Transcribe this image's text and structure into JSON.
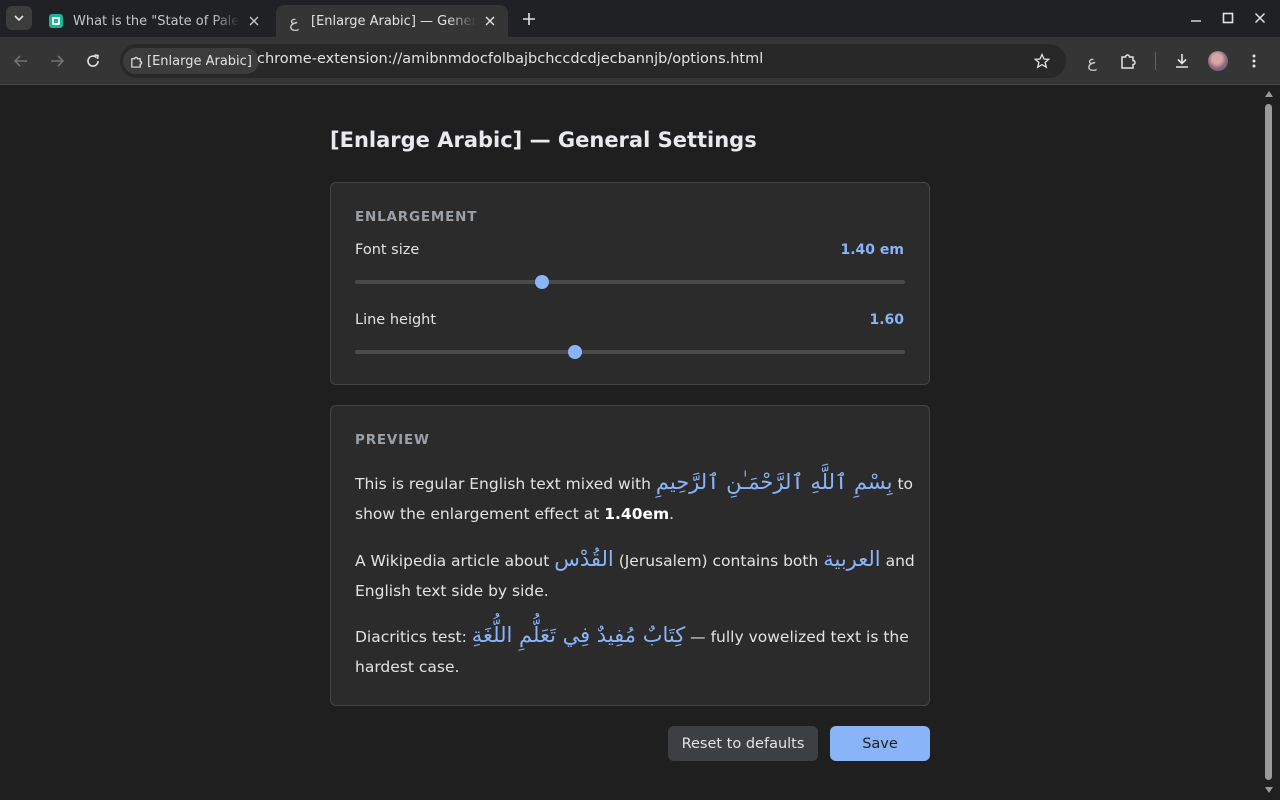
{
  "browser": {
    "tabs": [
      {
        "title": "What is the \"State of Palestine\"",
        "active": false,
        "favicon": "notion-like-green-icon"
      },
      {
        "title": "[Enlarge Arabic] — General Settings",
        "active": true,
        "favicon": "arabic-ain-icon"
      }
    ],
    "site_chip": "[Enlarge Arabic]",
    "url": "chrome-extension://amibnmdocfolbajbchccdcdjecbannjb/options.html",
    "extension_glyph": "ع"
  },
  "page": {
    "title": "[Enlarge Arabic] — General Settings",
    "enlargement": {
      "section_label": "ENLARGEMENT",
      "font_size": {
        "label": "Font size",
        "value_text": "1.40 em",
        "fraction": 0.34
      },
      "line_height": {
        "label": "Line height",
        "value_text": "1.60",
        "fraction": 0.4
      }
    },
    "preview": {
      "section_label": "PREVIEW",
      "p1": {
        "before": "This is regular English text mixed with ",
        "arabic": "بِسْمِ ٱللَّهِ ٱلرَّحْمَـٰنِ ٱلرَّحِيمِ",
        "middle": " to show the enlargement effect at ",
        "bold": "1.40em",
        "after": "."
      },
      "p2": {
        "before": "A Wikipedia article about ",
        "arabic1": "القُدْس",
        "middle": " (Jerusalem) contains both ",
        "arabic2": "العربية",
        "after": " and English text side by side."
      },
      "p3": {
        "before": "Diacritics test: ",
        "arabic": "كِتَابٌ مُفِيدٌ فِي تَعَلُّمِ اللُّغَةِ",
        "after": " — fully vowelized text is the hardest case."
      }
    },
    "buttons": {
      "reset": "Reset to defaults",
      "save": "Save"
    }
  },
  "colors": {
    "accent": "#8ab4f8",
    "background": "#1f1f1f",
    "card": "#2b2b2b"
  }
}
